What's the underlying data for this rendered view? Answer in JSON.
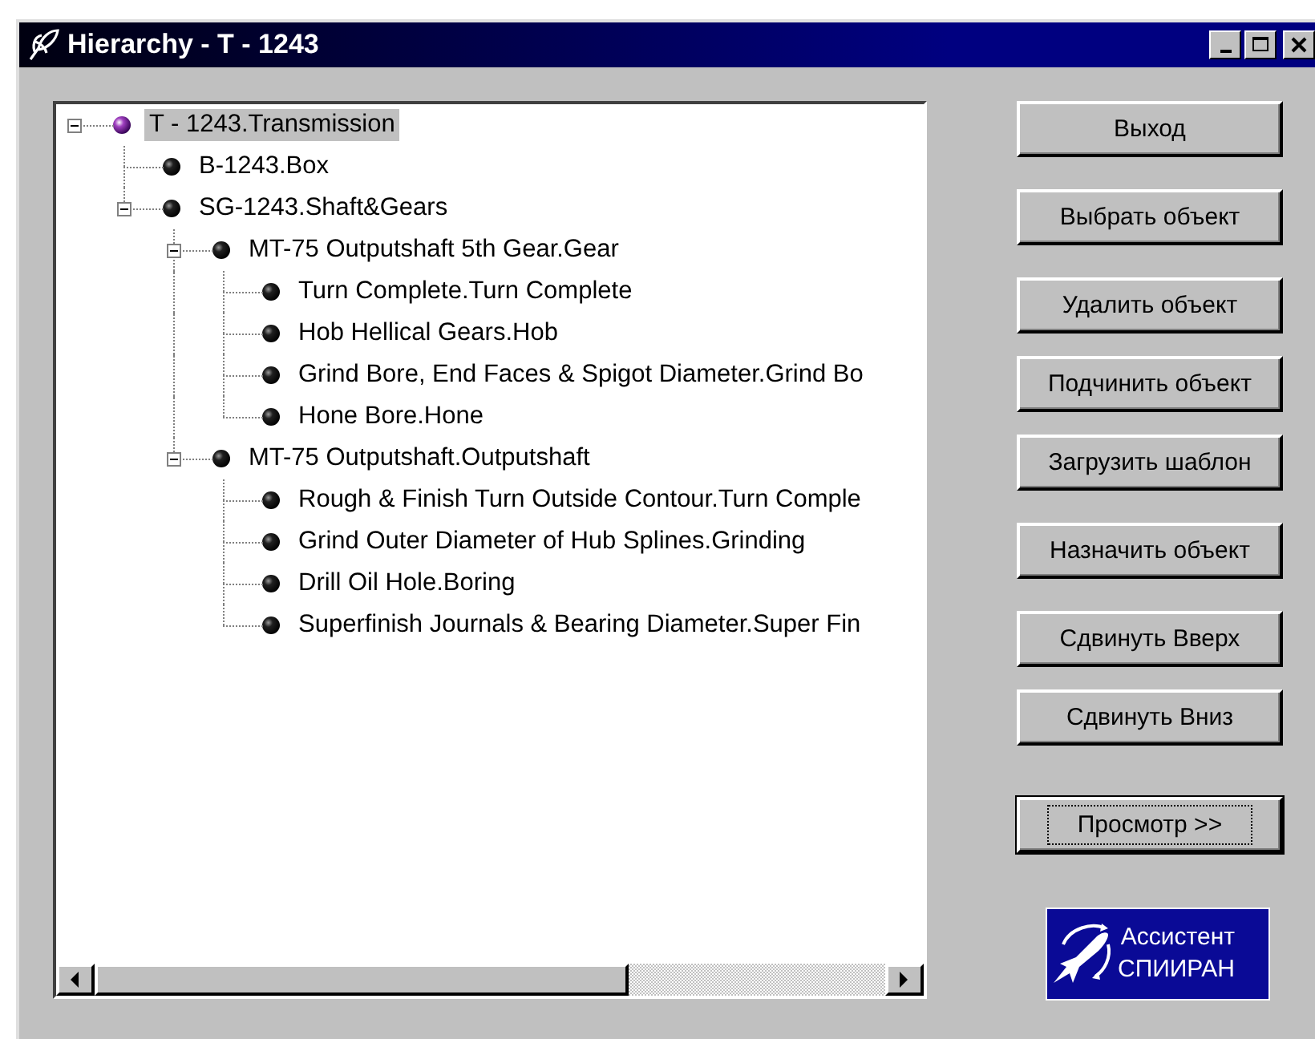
{
  "window": {
    "title": "Hierarchy - T - 1243"
  },
  "tree": [
    {
      "label": "T - 1243.Transmission",
      "kind": "root",
      "selected": true,
      "expanded": true,
      "children": [
        {
          "label": "B-1243.Box",
          "kind": "item",
          "selected": false
        },
        {
          "label": "SG-1243.Shaft&Gears",
          "kind": "item",
          "selected": false,
          "expanded": true,
          "children": [
            {
              "label": "MT-75 Outputshaft 5th Gear.Gear",
              "kind": "item",
              "selected": false,
              "expanded": true,
              "children": [
                {
                  "label": "Turn Complete.Turn Complete",
                  "kind": "item",
                  "selected": false
                },
                {
                  "label": "Hob Hellical Gears.Hob",
                  "kind": "item",
                  "selected": false
                },
                {
                  "label": "Grind Bore, End Faces & Spigot Diameter.Grind Bo",
                  "kind": "item",
                  "selected": false
                },
                {
                  "label": "Hone Bore.Hone",
                  "kind": "item",
                  "selected": false
                }
              ]
            },
            {
              "label": "MT-75 Outputshaft.Outputshaft",
              "kind": "item",
              "selected": false,
              "expanded": true,
              "children": [
                {
                  "label": "Rough & Finish Turn Outside Contour.Turn Comple",
                  "kind": "item",
                  "selected": false
                },
                {
                  "label": "Grind Outer Diameter of Hub Splines.Grinding",
                  "kind": "item",
                  "selected": false
                },
                {
                  "label": "Drill Oil Hole.Boring",
                  "kind": "item",
                  "selected": false
                },
                {
                  "label": "Superfinish Journals & Bearing Diameter.Super Fin",
                  "kind": "item",
                  "selected": false
                }
              ]
            }
          ]
        }
      ]
    }
  ],
  "button_groups": [
    [
      {
        "label": "Выход",
        "default": false
      }
    ],
    [
      {
        "label": "Выбрать объект",
        "default": false
      }
    ],
    [
      {
        "label": "Удалить объект",
        "default": false
      },
      {
        "label": "Подчинить объект",
        "default": false
      },
      {
        "label": "Загрузить шаблон",
        "default": false
      }
    ],
    [
      {
        "label": "Назначить объект",
        "default": false
      }
    ],
    [
      {
        "label": "Сдвинуть Вверх",
        "default": false
      },
      {
        "label": "Сдвинуть Вниз",
        "default": false
      }
    ],
    [
      {
        "label": "Просмотр >>",
        "default": true
      }
    ]
  ],
  "logo": {
    "lines": [
      "Ассистент",
      "СПИИРАН"
    ]
  }
}
